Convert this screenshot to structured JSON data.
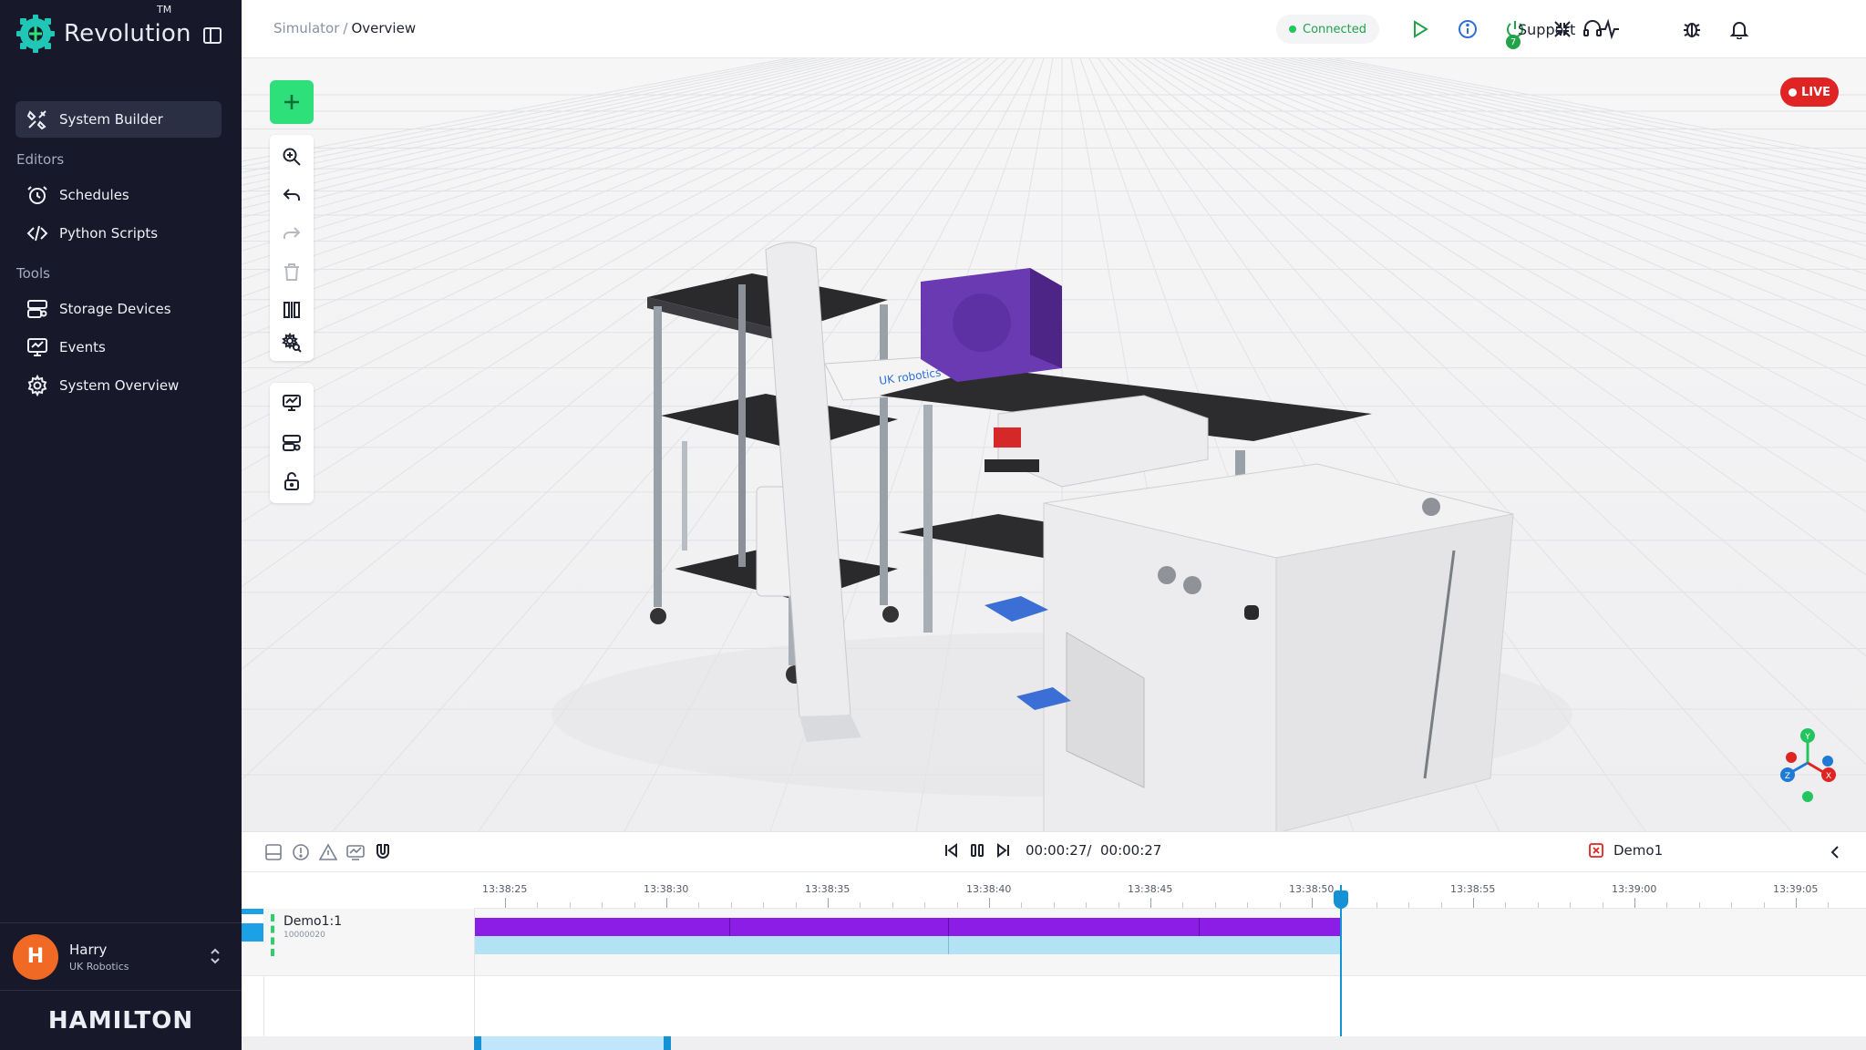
{
  "app": {
    "name": "Revolution",
    "trademark": "TM",
    "footer_logo": "HAMILTON"
  },
  "sidebar": {
    "active_item": "System Builder",
    "sections": {
      "editors": "Editors",
      "tools": "Tools"
    },
    "items": [
      {
        "label": "System Builder",
        "icon": "tools-icon"
      },
      {
        "label": "Schedules",
        "icon": "clock-icon"
      },
      {
        "label": "Python Scripts",
        "icon": "code-icon"
      },
      {
        "label": "Storage Devices",
        "icon": "storage-icon"
      },
      {
        "label": "Events",
        "icon": "monitor-chart-icon"
      },
      {
        "label": "System Overview",
        "icon": "gear-icon"
      }
    ],
    "user": {
      "initial": "H",
      "name": "Harry",
      "org": "UK Robotics"
    }
  },
  "topbar": {
    "breadcrumb_parent": "Simulator",
    "breadcrumb_separator": "/",
    "breadcrumb_current": "Overview",
    "status": "Connected",
    "power_badge": "7",
    "support_label": "Support"
  },
  "viewport": {
    "live_label": "LIVE",
    "robot_brand_text": "UK robotics",
    "axes": {
      "x": "X",
      "y": "Y",
      "z": "Z"
    }
  },
  "timeline": {
    "current_time": "00:00:27",
    "total_time": "00:00:27",
    "time_separator": "/",
    "demo_name": "Demo1",
    "track": {
      "name": "Demo1:1",
      "id": "10000020"
    },
    "ticks": [
      "13:38:25",
      "13:38:30",
      "13:38:35",
      "13:38:40",
      "13:38:45",
      "13:38:50",
      "13:38:55",
      "13:39:00",
      "13:39:05"
    ]
  },
  "colors": {
    "sidebar_bg": "#17192a",
    "accent_green": "#2ee07a",
    "live_red": "#e02424",
    "bar_purple": "#8b1de6",
    "bar_blue": "#b3e2f4",
    "playhead": "#1591d6"
  }
}
